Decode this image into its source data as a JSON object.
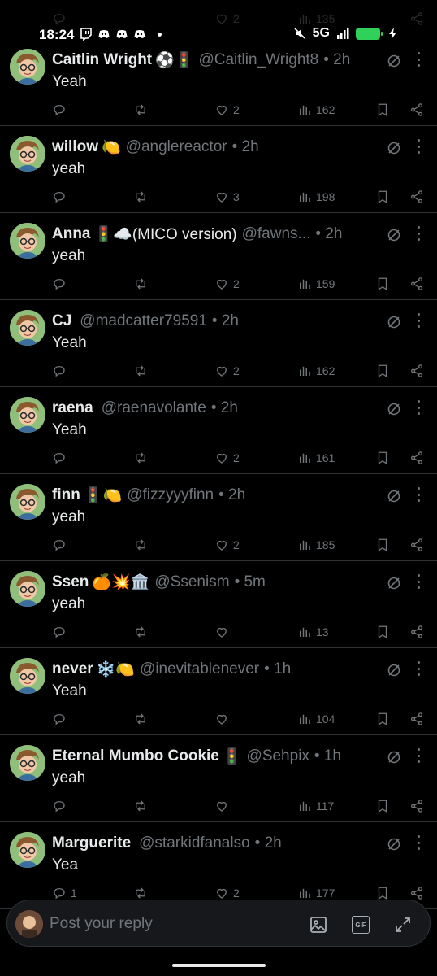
{
  "status_bar": {
    "time": "18:24",
    "network": "5G"
  },
  "peek": {
    "likes": "2",
    "views": "135"
  },
  "tweets": [
    {
      "name": "Caitlin Wright",
      "emoji": "⚽🚦",
      "handle": "@Caitlin_Wright8",
      "time": "• 2h",
      "text": "Yeah",
      "replies": "",
      "retweets": "",
      "likes": "2",
      "views": "162"
    },
    {
      "name": "willow",
      "emoji": "🍋",
      "handle": "@anglereactor",
      "time": "• 2h",
      "text": "yeah",
      "replies": "",
      "retweets": "",
      "likes": "3",
      "views": "198"
    },
    {
      "name": "Anna",
      "emoji": "🚦☁️(MICO version)",
      "handle": "@fawns...",
      "time": "• 2h",
      "text": "yeah",
      "replies": "",
      "retweets": "",
      "likes": "2",
      "views": "159"
    },
    {
      "name": "CJ",
      "emoji": "",
      "handle": "@madcatter79591",
      "time": "• 2h",
      "text": "Yeah",
      "replies": "",
      "retweets": "",
      "likes": "2",
      "views": "162"
    },
    {
      "name": "raena",
      "emoji": "",
      "handle": "@raenavolante",
      "time": "• 2h",
      "text": "Yeah",
      "replies": "",
      "retweets": "",
      "likes": "2",
      "views": "161"
    },
    {
      "name": "finn",
      "emoji": "🚦🍋",
      "handle": "@fizzyyyfinn",
      "time": "• 2h",
      "text": "yeah",
      "replies": "",
      "retweets": "",
      "likes": "2",
      "views": "185"
    },
    {
      "name": "Ssen",
      "emoji": "🍊💥🏛️",
      "handle": "@Ssenism",
      "time": "• 5m",
      "text": "yeah",
      "replies": "",
      "retweets": "",
      "likes": "",
      "views": "13"
    },
    {
      "name": "never",
      "emoji": "❄️🍋",
      "handle": "@inevitablenever",
      "time": "• 1h",
      "text": "Yeah",
      "replies": "",
      "retweets": "",
      "likes": "",
      "views": "104"
    },
    {
      "name": "Eternal Mumbo Cookie",
      "emoji": "🚦",
      "handle": "@Sehpix",
      "time": "• 1h",
      "text": "yeah",
      "replies": "",
      "retweets": "",
      "likes": "",
      "views": "117"
    },
    {
      "name": "Marguerite",
      "emoji": "",
      "handle": "@starkidfanalso",
      "time": "• 2h",
      "text": "Yea",
      "replies": "1",
      "retweets": "",
      "likes": "2",
      "views": "177"
    }
  ],
  "reply_bar": {
    "placeholder": "Post your reply",
    "gif_label": "GIF"
  },
  "colors": {
    "background": "#000000",
    "muted": "#71767b",
    "text": "#e7e9ea",
    "battery": "#2fd158"
  }
}
